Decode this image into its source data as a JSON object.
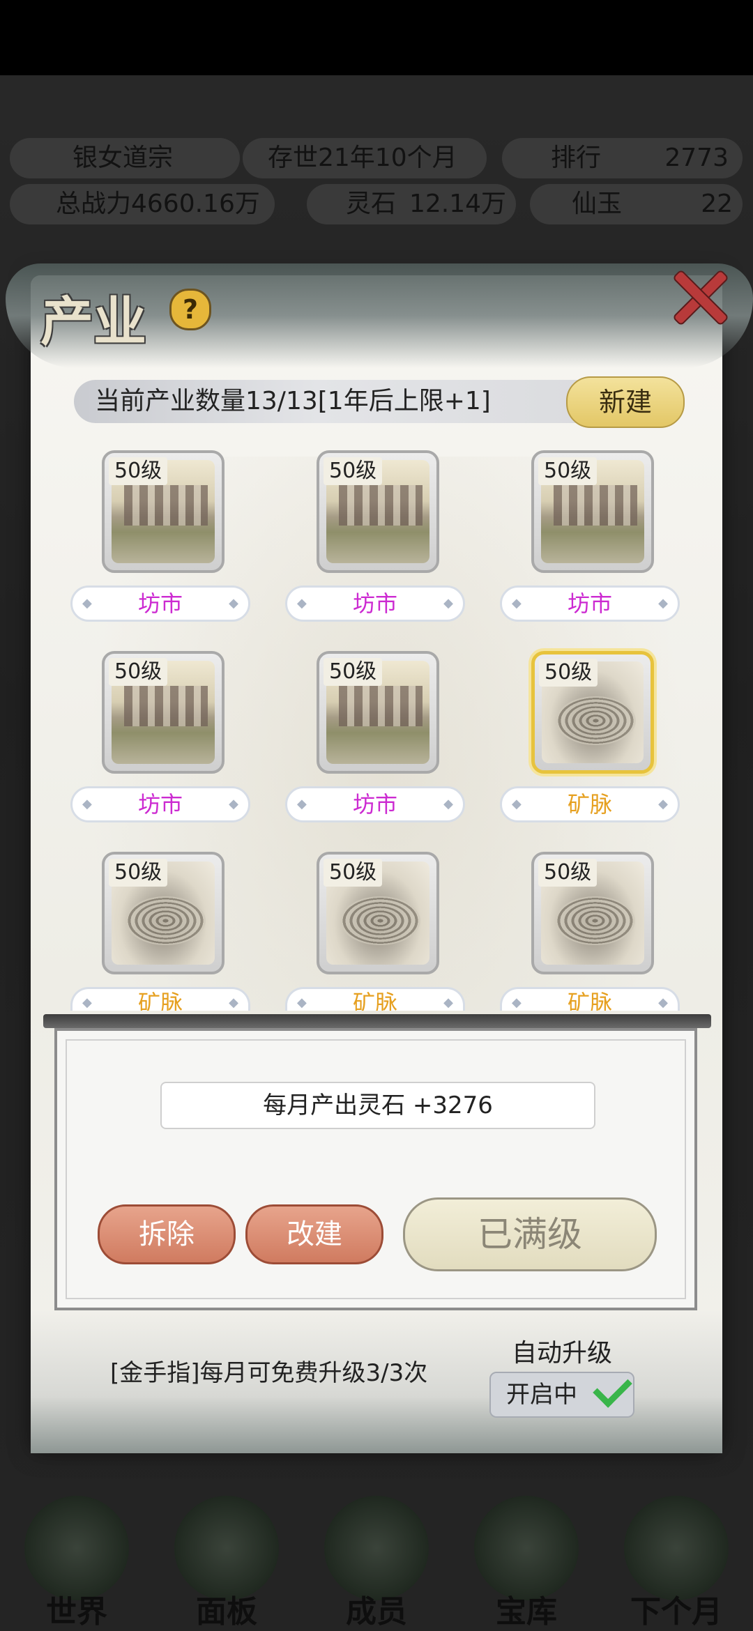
{
  "topbar": {
    "sect_name": "银女道宗",
    "age": "存世21年10个月",
    "rank_label": "排行",
    "rank_value": "2773",
    "power": "总战力4660.16万",
    "lingshi_label": "灵石",
    "lingshi_value": "12.14万",
    "xianyu_label": "仙玉",
    "xianyu_value": "22"
  },
  "bottom_nav": [
    "世界",
    "面板",
    "成员",
    "宝库",
    "下个月"
  ],
  "dialog": {
    "title": "产业",
    "help_icon": "?",
    "count_label": "当前产业数量13/13[1年后上限+1]",
    "new_button": "新建",
    "tiles": [
      {
        "level": "50级",
        "name": "坊市",
        "type": "market"
      },
      {
        "level": "50级",
        "name": "坊市",
        "type": "market"
      },
      {
        "level": "50级",
        "name": "坊市",
        "type": "market"
      },
      {
        "level": "50级",
        "name": "坊市",
        "type": "market"
      },
      {
        "level": "50级",
        "name": "坊市",
        "type": "market"
      },
      {
        "level": "50级",
        "name": "矿脉",
        "type": "mine",
        "selected": true
      },
      {
        "level": "50级",
        "name": "矿脉",
        "type": "mine"
      },
      {
        "level": "50级",
        "name": "矿脉",
        "type": "mine"
      },
      {
        "level": "50级",
        "name": "矿脉",
        "type": "mine"
      }
    ],
    "detail": {
      "output": "每月产出灵石 +3276",
      "demolish_button": "拆除",
      "rebuild_button": "改建",
      "max_button": "已满级"
    },
    "golden_finger": "[金手指]每月可免费升级3/3次",
    "auto_upgrade_label": "自动升级",
    "auto_upgrade_state": "开启中"
  },
  "colors": {
    "market_name": "#cc2ad1",
    "mine_name": "#e6a020",
    "selected_border": "#e7c33d"
  }
}
